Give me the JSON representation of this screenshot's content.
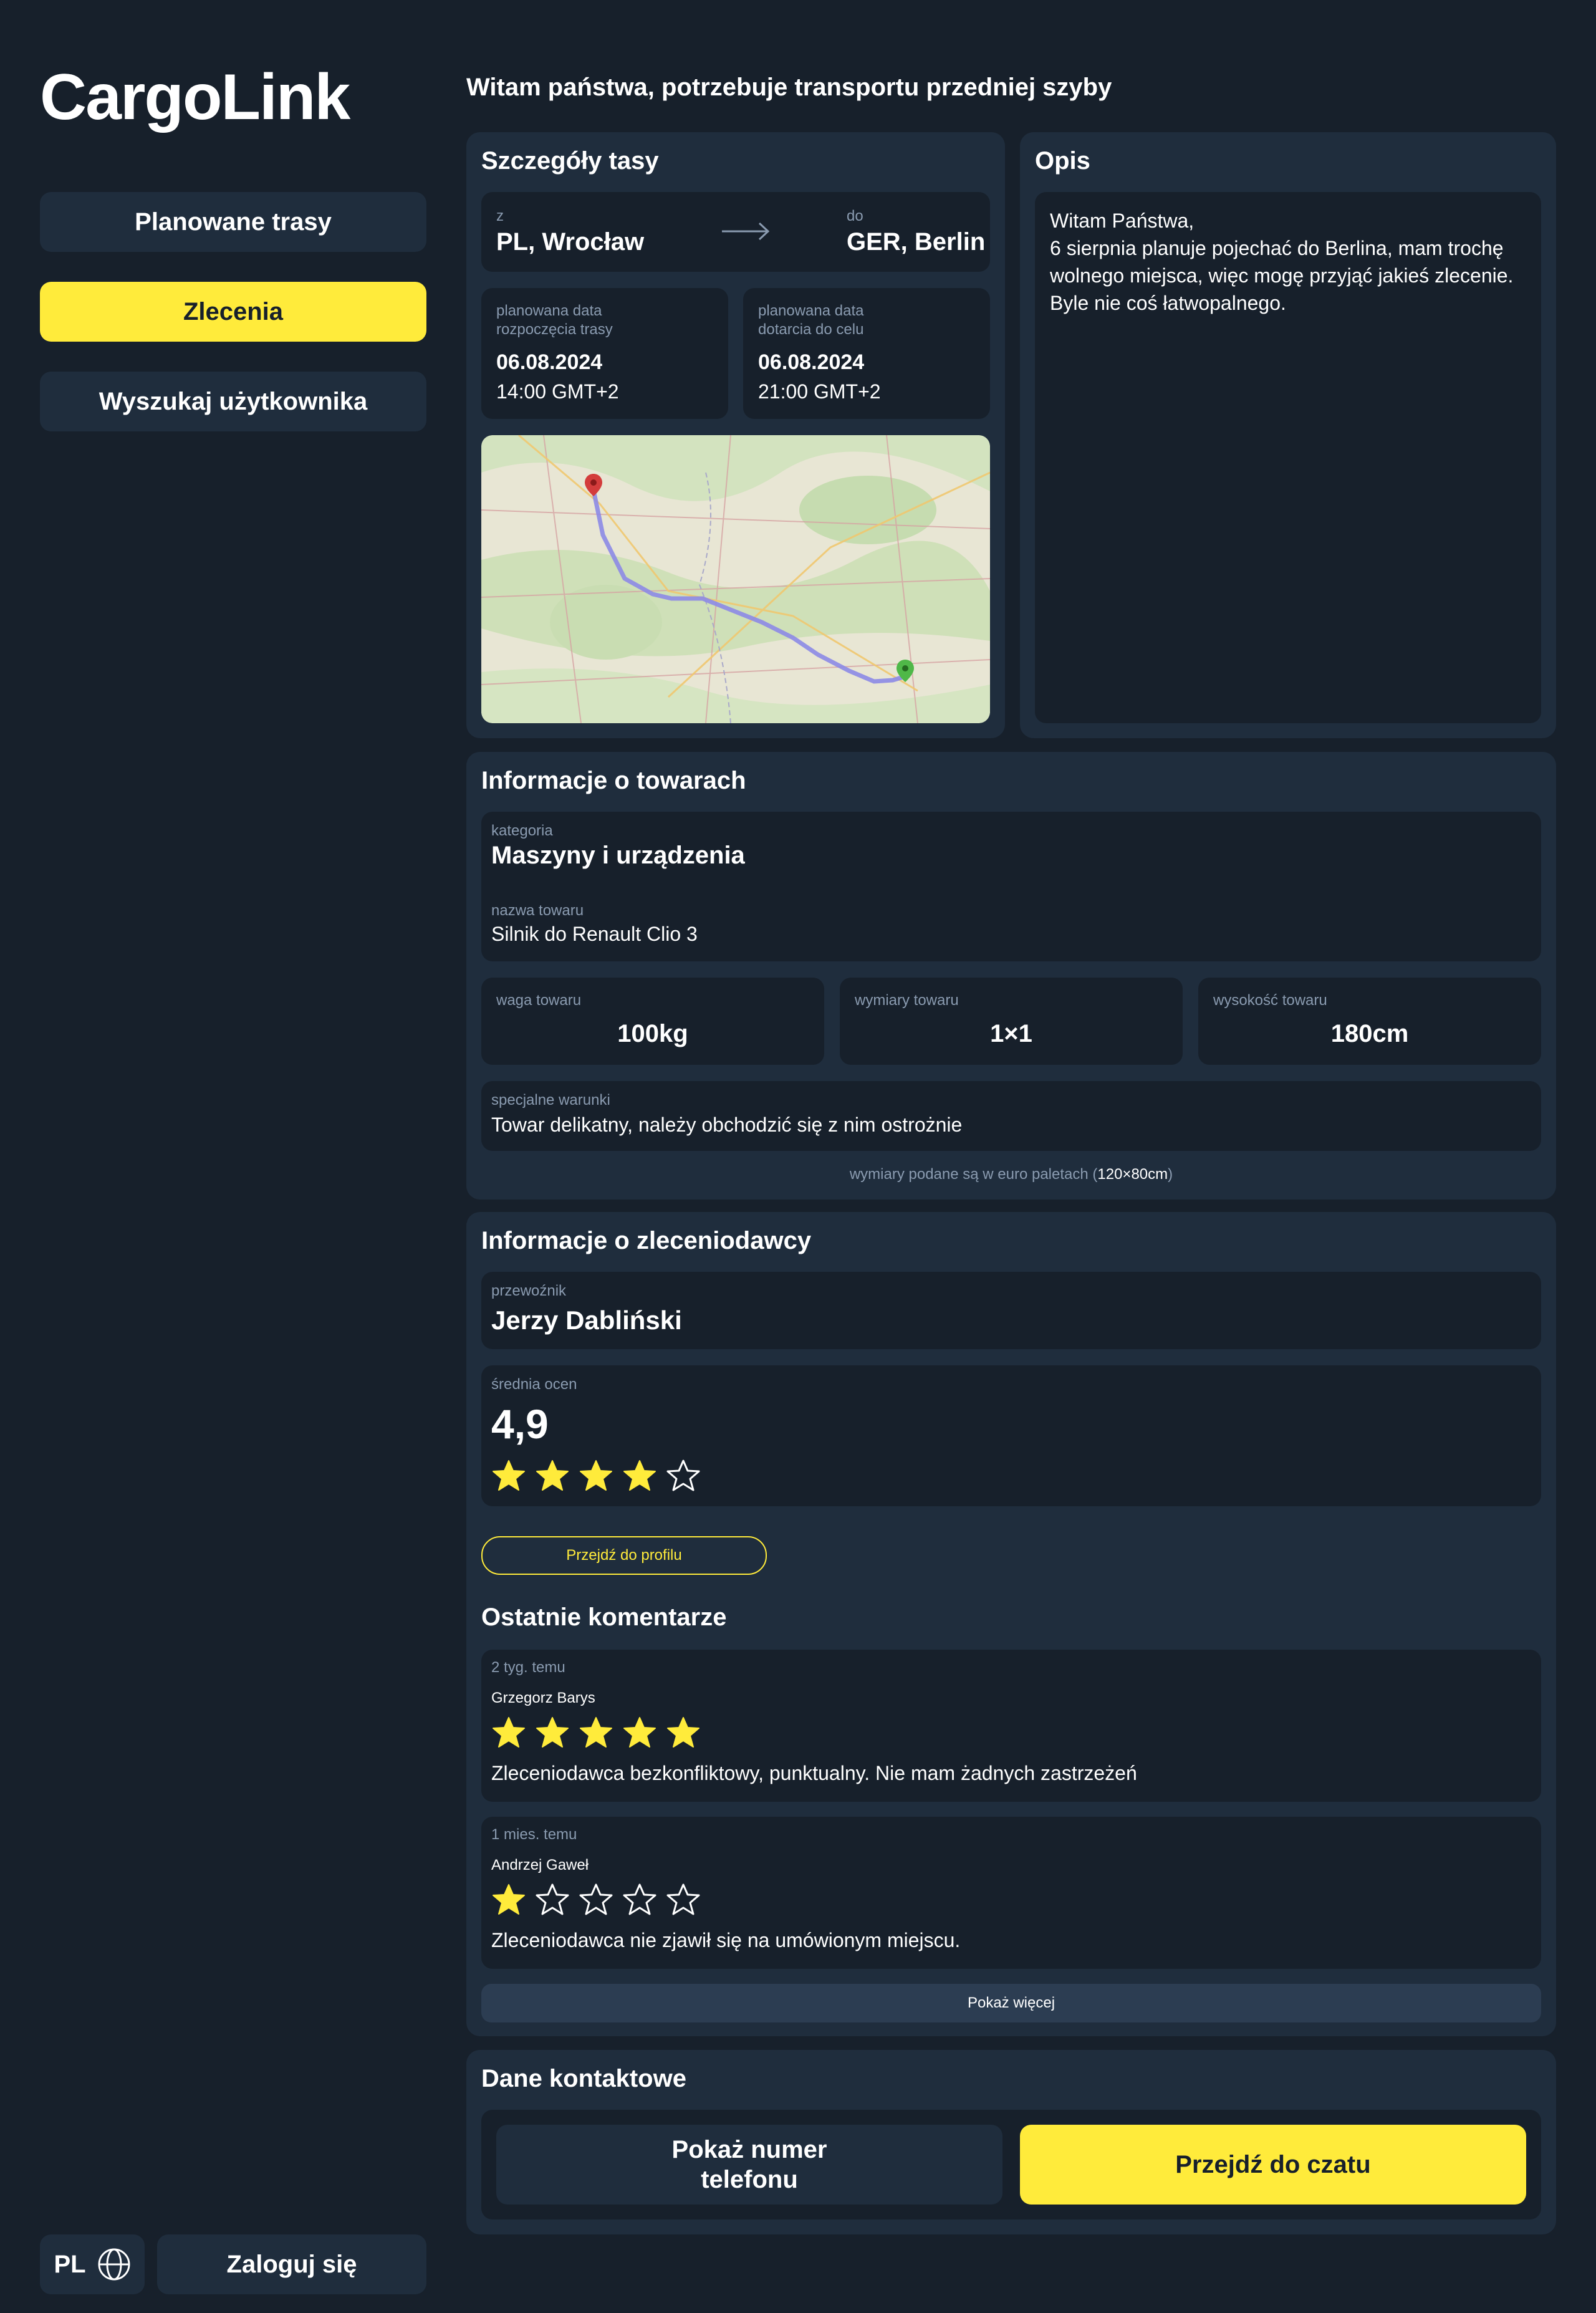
{
  "app": {
    "logo": "CargoLink"
  },
  "sidebar": {
    "items": [
      {
        "label": "Planowane trasy",
        "active": false
      },
      {
        "label": "Zlecenia",
        "active": true
      },
      {
        "label": "Wyszukaj użytkownika",
        "active": false
      }
    ],
    "language": "PL",
    "login_label": "Zaloguj się"
  },
  "header": {
    "title": "Witam państwa, potrzebuje transportu przedniej szyby"
  },
  "route": {
    "title": "Szczegóły tasy",
    "from_label": "z",
    "from": "PL, Wrocław",
    "to_label": "do",
    "to": "GER, Berlin",
    "start_label": "planowana data\nrozpoczęcia trasy",
    "start_date": "06.08.2024",
    "start_time": "14:00 GMT+2",
    "end_label": "planowana data\ndotarcia do celu",
    "end_date": "06.08.2024",
    "end_time": "21:00 GMT+2"
  },
  "description": {
    "title": "Opis",
    "text": "Witam Państwa,\n6 sierpnia planuje pojechać do Berlina, mam trochę wolnego miejsca, więc mogę przyjąć jakieś zlecenie. Byle nie coś łatwopalnego."
  },
  "goods": {
    "title": "Informacje o towarach",
    "category_label": "kategoria",
    "category": "Maszyny i urządzenia",
    "name_label": "nazwa towaru",
    "name": "Silnik do Renault Clio 3",
    "weight_label": "waga towaru",
    "weight": "100kg",
    "dims_label": "wymiary towaru",
    "dims": "1×1",
    "height_label": "wysokość towaru",
    "height": "180cm",
    "special_label": "specjalne warunki",
    "special": "Towar delikatny, należy obchodzić się z nim ostrożnie",
    "note_prefix": "wymiary podane są w euro paletach (",
    "note_value": "120×80cm",
    "note_suffix": ")"
  },
  "client": {
    "title": "Informacje o zleceniodawcy",
    "carrier_label": "przewoźnik",
    "carrier": "Jerzy Dabliński",
    "rating_label": "średnia ocen",
    "rating": "4,9",
    "rating_stars": 4,
    "profile_button": "Przejdź do profilu",
    "comments_title": "Ostatnie komentarze",
    "comments": [
      {
        "time": "2 tyg. temu",
        "author": "Grzegorz Barys",
        "stars": 5,
        "text": "Zleceniodawca bezkonfliktowy, punktualny. Nie mam żadnych zastrzeżeń"
      },
      {
        "time": "1 mies. temu",
        "author": "Andrzej Gaweł",
        "stars": 1,
        "text": "Zleceniodawca nie zjawił się na umówionym miejscu."
      }
    ],
    "more_button": "Pokaż więcej"
  },
  "contact": {
    "title": "Dane kontaktowe",
    "phone_button": "Pokaż numer\ntelefonu",
    "chat_button": "Przejdź do czatu"
  },
  "colors": {
    "accent": "#ffeb3b",
    "background": "#17202b",
    "panel": "#1f2d3d"
  }
}
